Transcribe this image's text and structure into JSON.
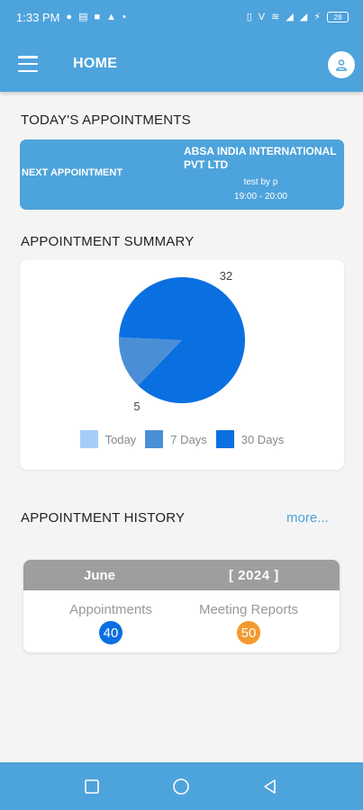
{
  "status_bar": {
    "time": "1:33 PM",
    "battery": "28"
  },
  "header": {
    "title": "HOME"
  },
  "today": {
    "section_title": "TODAY'S APPOINTMENTS",
    "next_label": "NEXT APPOINTMENT",
    "company": "ABSA INDIA INTERNATIONAL PVT LTD",
    "created_by": "test by p",
    "time_range": "19:00 - 20:00"
  },
  "summary": {
    "section_title": "APPOINTMENT SUMMARY"
  },
  "chart_data": {
    "type": "pie",
    "labels": [
      "Today",
      "7 Days",
      "30 Days"
    ],
    "values": [
      0,
      5,
      32
    ],
    "data_labels": [
      "5",
      "32"
    ],
    "colors": [
      "#a5cdf5",
      "#4a8fd6",
      "#0a6fe0"
    ],
    "legend_position": "bottom"
  },
  "history": {
    "section_title": "APPOINTMENT HISTORY",
    "more_label": "more...",
    "month": "June",
    "year": "[ 2024 ]",
    "appointments_label": "Appointments",
    "appointments_count": "40",
    "appointments_color": "#0a6fe0",
    "reports_label": "Meeting Reports",
    "reports_count": "50",
    "reports_color": "#f29a2e"
  }
}
